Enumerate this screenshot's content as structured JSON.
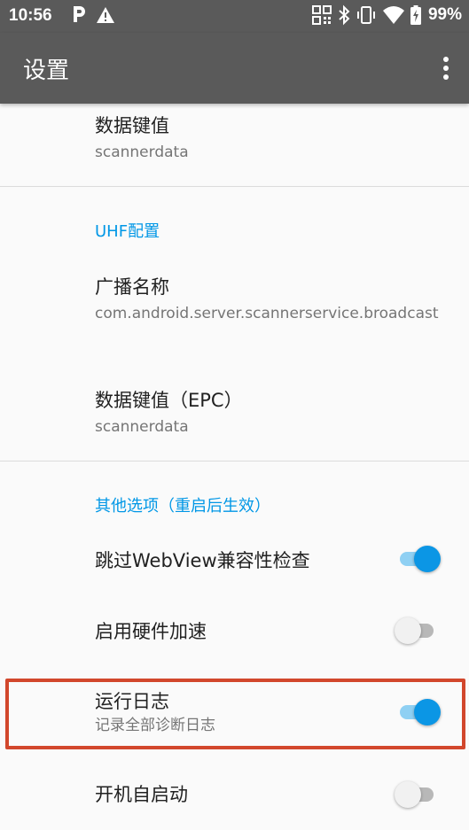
{
  "status_bar": {
    "time": "10:56",
    "battery": "99%",
    "icons": [
      "parking-icon",
      "warning-icon",
      "barcode-icon",
      "bluetooth-icon",
      "vibrate-icon",
      "wifi-icon",
      "battery-icon"
    ]
  },
  "app_bar": {
    "title": "设置",
    "overflow_icon": "more-vert-icon"
  },
  "settings": {
    "data_key": {
      "title": "数据键值",
      "summary": "scannerdata"
    },
    "uhf_category": "UHF配置",
    "broadcast_name": {
      "title": "广播名称",
      "summary": "com.android.server.scannerservice.broadcast"
    },
    "data_key_epc": {
      "title": "数据键值（EPC）",
      "summary": "scannerdata"
    },
    "other_category": "其他选项（重启后生效）",
    "skip_webview": {
      "title": "跳过WebView兼容性检查",
      "enabled": true
    },
    "hw_accel": {
      "title": "启用硬件加速",
      "enabled": false
    },
    "run_log": {
      "title": "运行日志",
      "summary": "记录全部诊断日志",
      "enabled": true
    },
    "autostart": {
      "title": "开机自启动",
      "enabled": false
    }
  },
  "colors": {
    "bar": "#5a5a5a",
    "accent": "#0097e6",
    "switch_on": "#0b96e5",
    "highlight": "#d2472c"
  }
}
